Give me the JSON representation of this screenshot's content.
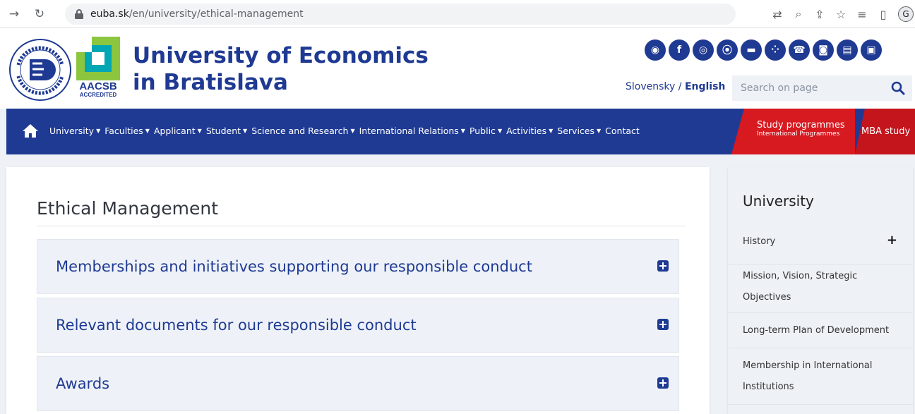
{
  "browser": {
    "url_host": "euba.sk",
    "url_path": "/en/university/ethical-management",
    "avatar_letter": "G"
  },
  "header": {
    "title_line1": "University of Economics",
    "title_line2": "in Bratislava",
    "aacsb_label": "AACSB",
    "aacsb_sub": "ACCREDITED",
    "lang_sk": "Slovensky",
    "lang_sep": " / ",
    "lang_en": "English",
    "search_placeholder": "Search on page",
    "social_icons": [
      "rss-icon",
      "facebook-icon",
      "instagram-icon",
      "restaurant-icon",
      "accommodation-icon",
      "network-icon",
      "phone-icon",
      "camera-icon",
      "library-icon",
      "elearning-icon"
    ]
  },
  "nav": {
    "items": [
      {
        "label": "University",
        "dropdown": true
      },
      {
        "label": "Faculties",
        "dropdown": true
      },
      {
        "label": "Applicant",
        "dropdown": true
      },
      {
        "label": "Student",
        "dropdown": true
      },
      {
        "label": "Science and Research",
        "dropdown": true
      },
      {
        "label": "International Relations",
        "dropdown": true
      },
      {
        "label": "Public",
        "dropdown": true
      },
      {
        "label": "Activities",
        "dropdown": true
      },
      {
        "label": "Services",
        "dropdown": true
      },
      {
        "label": "Contact",
        "dropdown": false
      }
    ],
    "study_title": "Study programmes",
    "study_sub": "International Programmes",
    "mba": "MBA study"
  },
  "main": {
    "page_title": "Ethical Management",
    "accordion": [
      {
        "label": "Memberships and initiatives supporting our responsible conduct"
      },
      {
        "label": "Relevant documents for our responsible conduct"
      },
      {
        "label": "Awards"
      }
    ]
  },
  "sidebar": {
    "title": "University",
    "items": [
      {
        "line1": "History",
        "line2": ""
      },
      {
        "line1": "Mission, Vision, Strategic",
        "line2": "Objectives"
      },
      {
        "line1": "Long-term Plan of Development",
        "line2": ""
      },
      {
        "line1": "Membership in International",
        "line2": "Institutions"
      }
    ]
  }
}
